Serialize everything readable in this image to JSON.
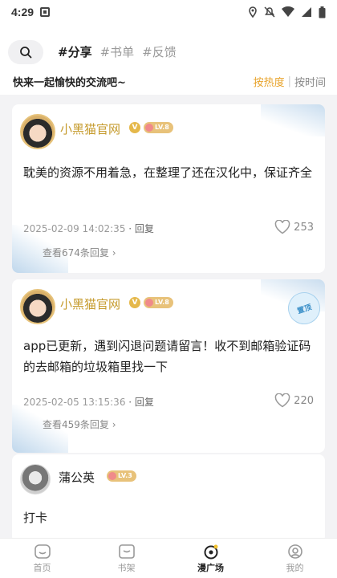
{
  "status": {
    "time": "4:29"
  },
  "top": {
    "tags": [
      "#分享",
      "#书单",
      "#反馈"
    ],
    "subtitle": "快来一起愉快的交流吧~",
    "sort": {
      "hot": "按热度",
      "sep": "|",
      "time": "按时间"
    }
  },
  "posts": [
    {
      "user": "小黑猫官网",
      "level": "LV.8",
      "content": "耽美的资源不用着急，在整理了还在汉化中，保证齐全",
      "date": "2025-02-09 14:02:35",
      "reply_label": "· 回复",
      "likes": "253",
      "see_replies": "查看674条回复"
    },
    {
      "user": "小黑猫官网",
      "level": "LV.8",
      "sticker": "置顶",
      "content": "app已更新，遇到闪退问题请留言！收不到邮箱验证码的去邮箱的垃圾箱里找一下",
      "date": "2025-02-05 13:15:36",
      "reply_label": "· 回复",
      "likes": "220",
      "see_replies": "查看459条回复"
    },
    {
      "user": "蒲公英",
      "level": "LV.3",
      "content": "打卡"
    }
  ],
  "nav": {
    "items": [
      {
        "label": "首页",
        "icon": "home-icon"
      },
      {
        "label": "书架",
        "icon": "bookshelf-icon"
      },
      {
        "label": "漫广场",
        "icon": "plaza-icon"
      },
      {
        "label": "我的",
        "icon": "profile-icon"
      }
    ],
    "active_index": 2
  },
  "colors": {
    "accent": "#e8a32a",
    "gold": "#c59a2b",
    "background": "#f3f3f5"
  }
}
